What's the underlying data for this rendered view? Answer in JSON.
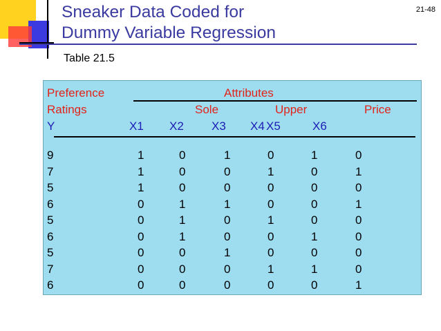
{
  "slide": {
    "title": "Sneaker Data Coded for Dummy Variable Regression",
    "title_line1": "Sneaker Data Coded for",
    "title_line2": "Dummy Variable Regression",
    "slide_number": "21-48",
    "table_label": "Table 21.5"
  },
  "colors": {
    "title": "#3a3aa0",
    "header_red": "#e2231a",
    "header_blue": "#1d1db5",
    "table_background": "#9edcf0",
    "deco_yellow": "#ffd21f",
    "deco_blue": "#3a3ae0",
    "deco_red": "#ff3a3a"
  },
  "table": {
    "header_row1": {
      "preference": "Preference",
      "attributes": "Attributes"
    },
    "header_row2": {
      "ratings": "Ratings",
      "sole": "Sole",
      "upper": "Upper",
      "price": "Price"
    },
    "header_row3": {
      "y": "Y",
      "x1": "X1",
      "x2": "X2",
      "x3": "X3",
      "x4": "X4",
      "x5": "X5",
      "x6": "X6"
    },
    "rows": [
      [
        "9",
        "1",
        "0",
        "1",
        "0",
        "1",
        "0"
      ],
      [
        "7",
        "1",
        "0",
        "0",
        "1",
        "0",
        "1"
      ],
      [
        "5",
        "1",
        "0",
        "0",
        "0",
        "0",
        "0"
      ],
      [
        "6",
        "0",
        "1",
        "1",
        "0",
        "0",
        "1"
      ],
      [
        "5",
        "0",
        "1",
        "0",
        "1",
        "0",
        "0"
      ],
      [
        "6",
        "0",
        "1",
        "0",
        "0",
        "1",
        "0"
      ],
      [
        "5",
        "0",
        "0",
        "1",
        "0",
        "0",
        "0"
      ],
      [
        "7",
        "0",
        "0",
        "0",
        "1",
        "1",
        "0"
      ],
      [
        "6",
        "0",
        "0",
        "0",
        "0",
        "0",
        "1"
      ]
    ]
  }
}
